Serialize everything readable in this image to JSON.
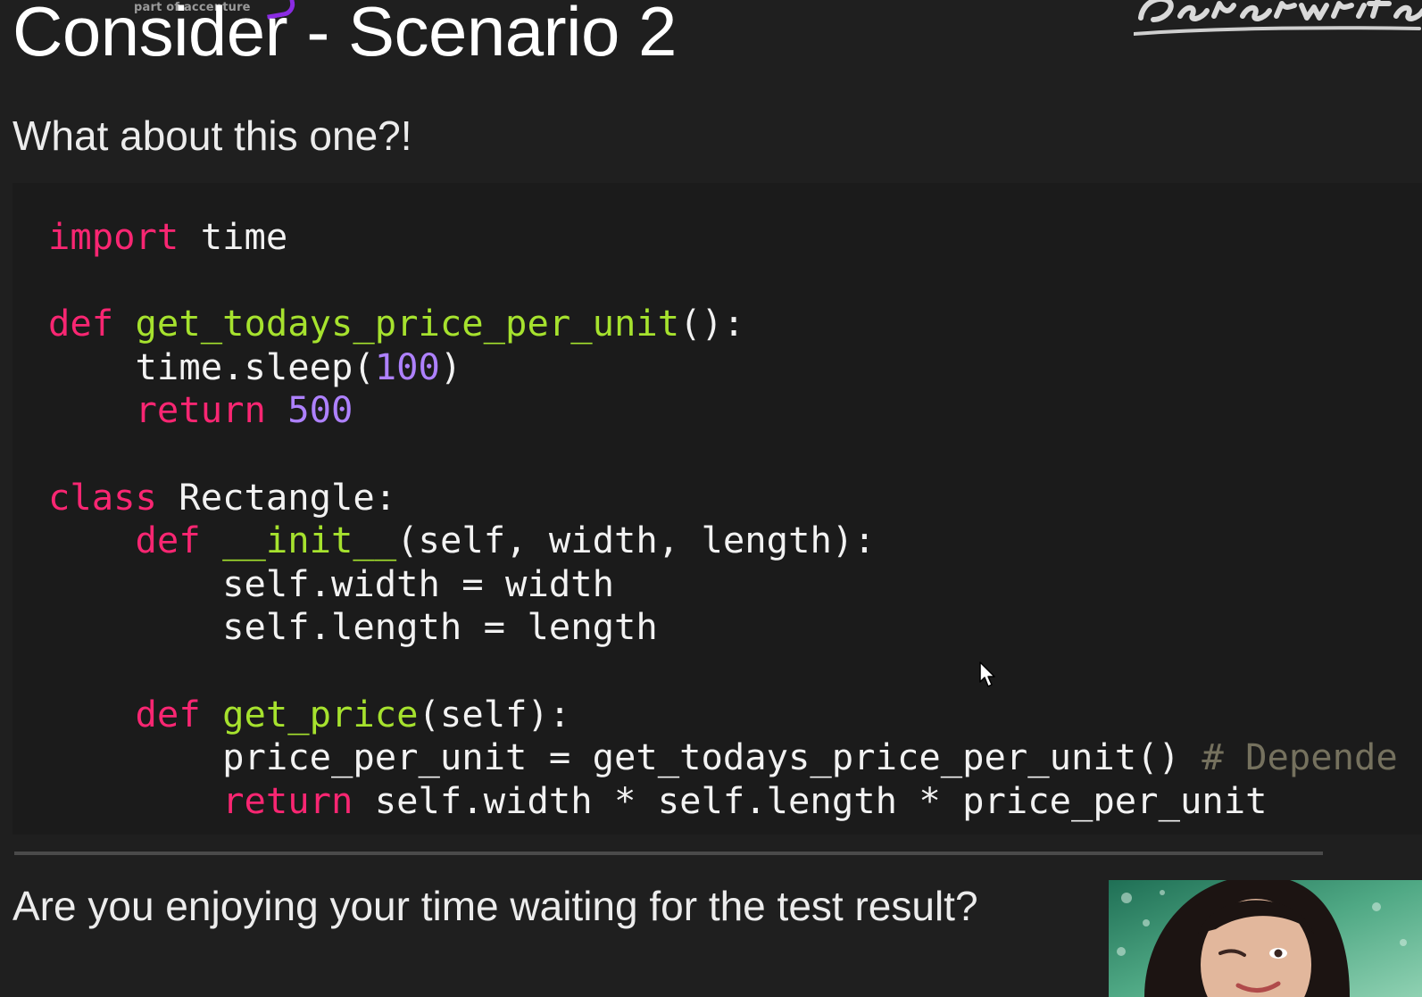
{
  "slide": {
    "brand_tag": "part of accenture",
    "title": "Consider - Scenario 2",
    "subtitle": "What about this one?!",
    "footer_question": "Are you enjoying your time waiting for the test result?"
  },
  "code_lines": [
    {
      "indent": "",
      "tokens": [
        {
          "t": "import",
          "k": "kw"
        },
        {
          "t": " time",
          "k": ""
        }
      ]
    },
    {
      "indent": "",
      "tokens": []
    },
    {
      "indent": "",
      "tokens": [
        {
          "t": "def",
          "k": "kw"
        },
        {
          "t": " ",
          "k": ""
        },
        {
          "t": "get_todays_price_per_unit",
          "k": "fn"
        },
        {
          "t": "():",
          "k": ""
        }
      ]
    },
    {
      "indent": "    ",
      "tokens": [
        {
          "t": "time.sleep(",
          "k": ""
        },
        {
          "t": "100",
          "k": "num"
        },
        {
          "t": ")",
          "k": ""
        }
      ]
    },
    {
      "indent": "    ",
      "tokens": [
        {
          "t": "return",
          "k": "kw"
        },
        {
          "t": " ",
          "k": ""
        },
        {
          "t": "500",
          "k": "num"
        }
      ]
    },
    {
      "indent": "",
      "tokens": []
    },
    {
      "indent": "",
      "tokens": [
        {
          "t": "class",
          "k": "kw"
        },
        {
          "t": " Rectangle:",
          "k": ""
        }
      ]
    },
    {
      "indent": "    ",
      "tokens": [
        {
          "t": "def",
          "k": "kw"
        },
        {
          "t": " ",
          "k": ""
        },
        {
          "t": "__init__",
          "k": "fn"
        },
        {
          "t": "(self, width, length):",
          "k": ""
        }
      ]
    },
    {
      "indent": "        ",
      "tokens": [
        {
          "t": "self.width = width",
          "k": ""
        }
      ]
    },
    {
      "indent": "        ",
      "tokens": [
        {
          "t": "self.length = length",
          "k": ""
        }
      ]
    },
    {
      "indent": "",
      "tokens": []
    },
    {
      "indent": "    ",
      "tokens": [
        {
          "t": "def",
          "k": "kw"
        },
        {
          "t": " ",
          "k": ""
        },
        {
          "t": "get_price",
          "k": "fn"
        },
        {
          "t": "(self):",
          "k": ""
        }
      ]
    },
    {
      "indent": "        ",
      "tokens": [
        {
          "t": "price_per_unit = get_todays_price_per_unit() ",
          "k": ""
        },
        {
          "t": "# Depende",
          "k": "cm"
        }
      ]
    },
    {
      "indent": "        ",
      "tokens": [
        {
          "t": "return",
          "k": "kw"
        },
        {
          "t": " self.width * self.length * price_per_unit",
          "k": ""
        }
      ]
    }
  ],
  "colors": {
    "background": "#1f1f1f",
    "keyword": "#f92672",
    "function": "#a6e22e",
    "number": "#ae81ff",
    "comment": "#75715e",
    "brand_accent": "#8a2be2"
  },
  "icons": {
    "cursor": "mouse-pointer-icon",
    "logo": "handwritten-brand-logo"
  }
}
